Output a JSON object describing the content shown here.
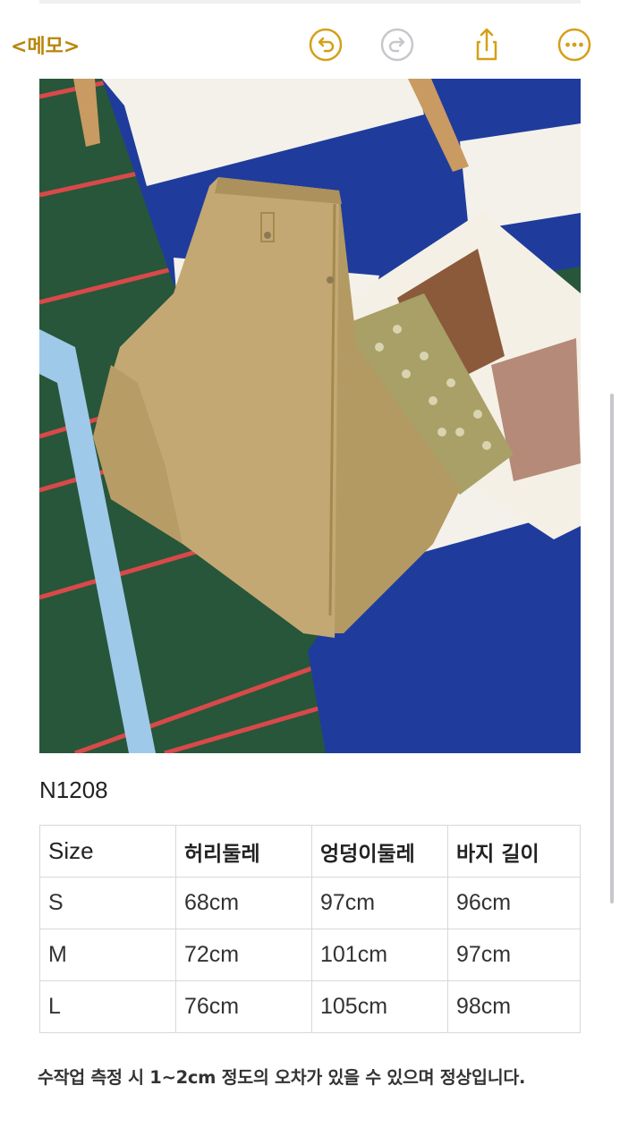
{
  "toolbar": {
    "back_label": "<메모>",
    "accent_color": "#D4A017",
    "icons": [
      "undo-icon",
      "redo-icon",
      "share-icon",
      "more-icon"
    ]
  },
  "note": {
    "product_code": "N1208",
    "size_table": {
      "headers": [
        "Size",
        "허리둘레",
        "엉덩이둘레",
        "바지 길이"
      ],
      "rows": [
        [
          "S",
          "68cm",
          "97cm",
          "96cm"
        ],
        [
          "M",
          "72cm",
          "101cm",
          "97cm"
        ],
        [
          "L",
          "76cm",
          "105cm",
          "98cm"
        ]
      ]
    },
    "footnote": "수작업 측정 시 1~2cm 정도의 오차가 있을 수 있으며 정상입니다."
  }
}
